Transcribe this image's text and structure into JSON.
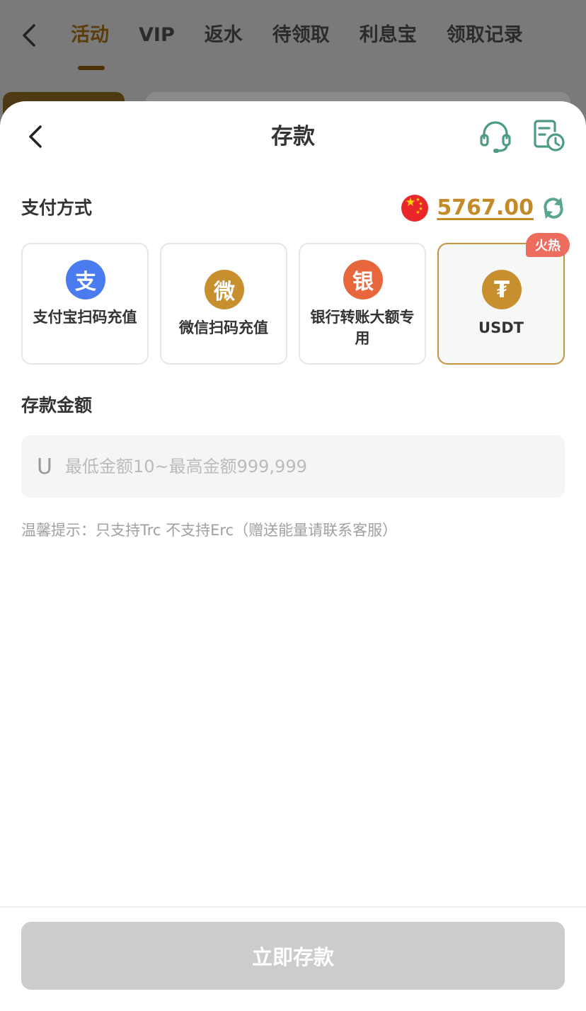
{
  "background_page": {
    "tabs": [
      "活动",
      "VIP",
      "返水",
      "待领取",
      "利息宝",
      "领取记录"
    ],
    "active_tab": "活动"
  },
  "sheet": {
    "title": "存款",
    "payment_section_label": "支付方式",
    "balance": "5767.00",
    "methods": [
      {
        "icon_char": "支",
        "name": "支付宝扫码充值",
        "icon_color": "#4a7cf0",
        "icon": "alipay-icon"
      },
      {
        "icon_char": "微",
        "name": "微信扫码充值",
        "icon_color": "#c78f2e",
        "icon": "wechat-icon"
      },
      {
        "icon_char": "银",
        "name": "银行转账大额专用",
        "icon_color": "#e7663c",
        "icon": "bank-icon"
      },
      {
        "icon_char": "₮",
        "name": "USDT",
        "icon_color": "#c78f2e",
        "icon": "usdt-icon",
        "badge": "火热",
        "selected": true
      }
    ],
    "amount_section_label": "存款金额",
    "amount_input": {
      "prefix": "U",
      "value": "",
      "placeholder": "最低金额10~最高金额999,999"
    },
    "tip": "温馨提示：只支持Trc 不支持Erc（赠送能量请联系客服）",
    "submit_label": "立即存款"
  },
  "colors": {
    "accent": "#c69440",
    "balance": "#c48a2a",
    "support_icon": "#4d9a86",
    "hot_badge": "#ec6c5e",
    "submit_disabled": "#cccccc"
  }
}
